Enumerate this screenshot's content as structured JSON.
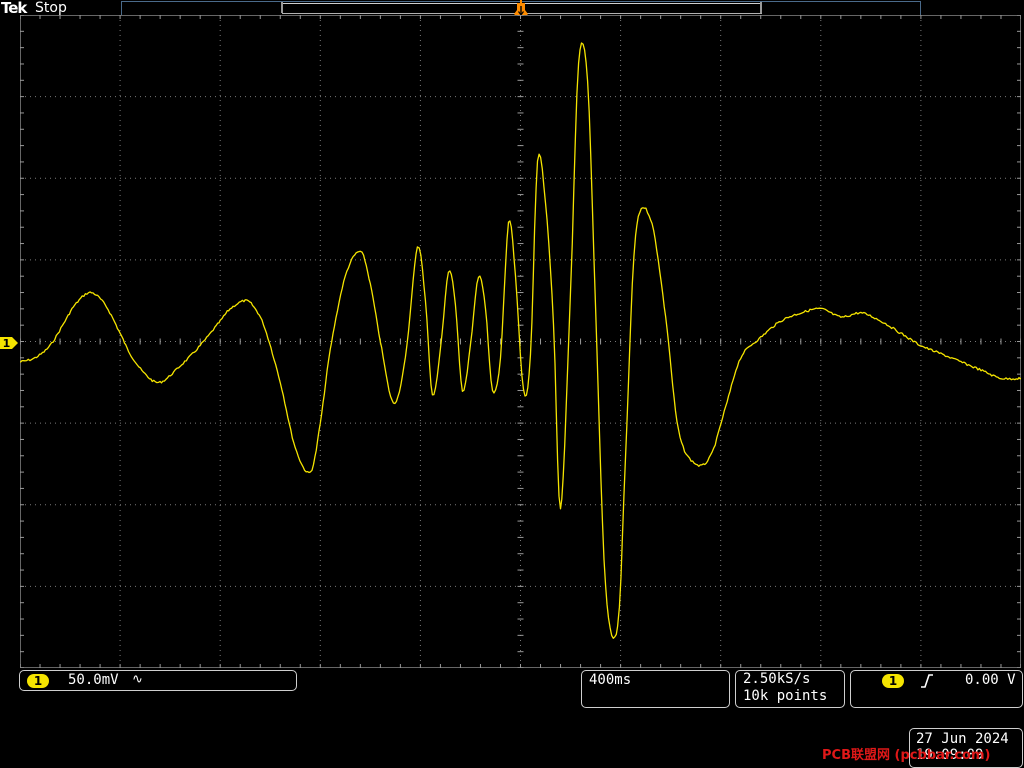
{
  "header": {
    "brand": "Tek",
    "acq_status": "Stop"
  },
  "channel": {
    "number": "1",
    "scale": "50.0mV",
    "coupling_symbol": "∿",
    "color": "#f5e400"
  },
  "horizontal": {
    "time_per_div": "400ms"
  },
  "acquisition": {
    "sample_rate": "2.50kS/s",
    "record_length": "10k points"
  },
  "trigger": {
    "source": "1",
    "slope_symbol": "rising-edge-icon",
    "level": "0.00 V",
    "marker_color": "#ff8c00"
  },
  "timestamp": {
    "date": "27 Jun 2024",
    "time": "19:09:09"
  },
  "watermark": {
    "text": "PCB联盟网 (pcbbar.com)"
  },
  "chart_data": {
    "type": "line",
    "x_unit": "divisions",
    "y_unit": "divisions",
    "xlim": [
      0,
      10
    ],
    "ylim": [
      -4,
      4
    ],
    "grid": true,
    "series": [
      {
        "color": "#f5e400",
        "x": [
          0.0,
          0.15,
          0.3,
          0.45,
          0.55,
          0.7,
          0.85,
          1.0,
          1.1,
          1.25,
          1.4,
          1.6,
          1.8,
          2.0,
          2.1,
          2.25,
          2.35,
          2.45,
          2.6,
          2.75,
          2.9,
          3.0,
          3.1,
          3.25,
          3.4,
          3.5,
          3.6,
          3.73,
          3.85,
          3.97,
          4.05,
          4.12,
          4.2,
          4.28,
          4.35,
          4.42,
          4.5,
          4.58,
          4.65,
          4.72,
          4.8,
          4.88,
          4.95,
          5.03,
          5.1,
          5.17,
          5.25,
          5.33,
          5.4,
          5.5,
          5.58,
          5.67,
          5.75,
          5.85,
          5.97,
          6.05,
          6.15,
          6.3,
          6.45,
          6.58,
          6.75,
          6.9,
          7.05,
          7.2,
          7.4,
          7.6,
          7.8,
          8.0,
          8.2,
          8.4,
          8.6,
          8.8,
          9.0,
          9.2,
          9.4,
          9.6,
          9.8,
          10.0
        ],
        "y": [
          -0.25,
          -0.2,
          -0.05,
          0.25,
          0.45,
          0.6,
          0.45,
          0.1,
          -0.15,
          -0.4,
          -0.5,
          -0.3,
          -0.05,
          0.25,
          0.4,
          0.5,
          0.4,
          0.15,
          -0.5,
          -1.3,
          -1.6,
          -1.0,
          -0.1,
          0.8,
          1.1,
          0.7,
          0.0,
          -0.75,
          -0.2,
          1.15,
          0.5,
          -0.65,
          -0.1,
          0.85,
          0.45,
          -0.6,
          -0.05,
          0.8,
          0.4,
          -0.6,
          -0.2,
          1.45,
          0.8,
          -0.6,
          -0.15,
          2.2,
          1.7,
          0.2,
          -2.05,
          0.6,
          3.4,
          3.2,
          0.4,
          -3.0,
          -3.5,
          -1.4,
          1.3,
          1.5,
          0.3,
          -1.1,
          -1.5,
          -1.4,
          -0.8,
          -0.2,
          0.05,
          0.25,
          0.35,
          0.4,
          0.3,
          0.35,
          0.25,
          0.1,
          -0.05,
          -0.15,
          -0.25,
          -0.35,
          -0.45,
          -0.45
        ]
      }
    ]
  }
}
